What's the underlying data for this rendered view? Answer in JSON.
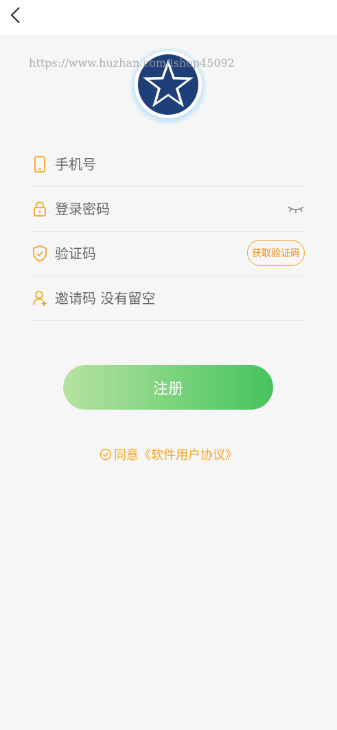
{
  "watermark": "https://www.huzhan.com/ishop45092",
  "form": {
    "phone_placeholder": "手机号",
    "password_placeholder": "登录密码",
    "code_placeholder": "验证码",
    "get_code_label": "获取验证码",
    "invite_placeholder": "邀请码 没有留空"
  },
  "register_label": "注册",
  "agreement_text": "同意《软件用户协议》",
  "colors": {
    "accent": "#f5a623",
    "logo_blue": "#1e3f7a",
    "button_start": "#b6e3a0",
    "button_end": "#46c45d"
  },
  "icons": {
    "back": "chevron-left-icon",
    "phone": "phone-icon",
    "lock": "lock-icon",
    "eye": "eye-closed-icon",
    "shield": "shield-check-icon",
    "user": "user-add-icon",
    "check": "check-circle-icon"
  }
}
